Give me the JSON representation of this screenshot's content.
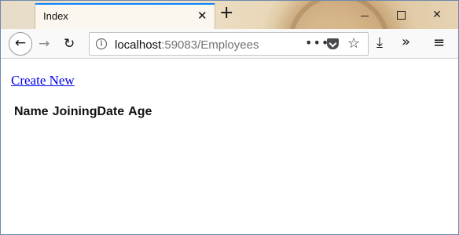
{
  "browser": {
    "tab": {
      "title": "Index",
      "close_glyph": "✕"
    },
    "new_tab_glyph": "+",
    "window_controls": {
      "close_glyph": "✕"
    },
    "nav": {
      "back_glyph": "←",
      "forward_glyph": "→",
      "reload_glyph": "↻",
      "url_host": "localhost",
      "url_rest": ":59083/Employees",
      "info_glyph": "i",
      "page_actions_glyph": "•••",
      "star_glyph": "☆",
      "download_glyph": "⤓",
      "overflow_glyph": "»",
      "menu_glyph": "≡"
    },
    "icons": [
      "info-icon",
      "pocket-icon",
      "star-icon",
      "download-icon",
      "overflow-icon",
      "menu-icon"
    ],
    "colors": {
      "tab_accent": "#0a84ff",
      "link": "#0000ee"
    }
  },
  "page": {
    "create_link": "Create New",
    "table_headers": [
      "Name",
      "JoiningDate",
      "Age"
    ]
  }
}
